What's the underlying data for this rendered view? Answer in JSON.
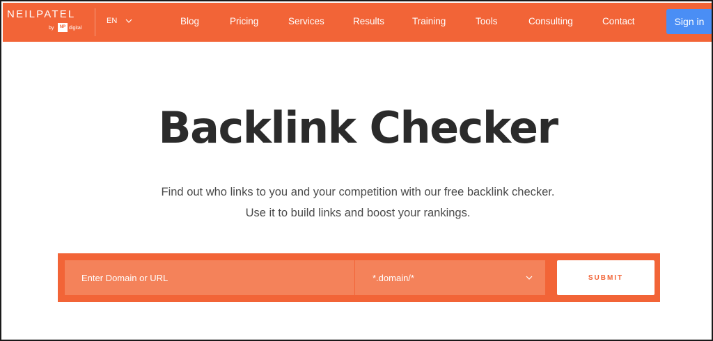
{
  "header": {
    "logo": {
      "wordmark": "NEILPATEL",
      "by": "by",
      "badge": "NP",
      "digital": "digital"
    },
    "language": "EN",
    "nav": [
      {
        "label": "Blog"
      },
      {
        "label": "Pricing"
      },
      {
        "label": "Services"
      },
      {
        "label": "Results"
      },
      {
        "label": "Training"
      },
      {
        "label": "Tools"
      },
      {
        "label": "Consulting"
      },
      {
        "label": "Contact"
      }
    ],
    "signin_label": "Sign in"
  },
  "hero": {
    "title": "Backlink Checker",
    "subtitle_line1": "Find out who links to you and your competition with our free backlink checker.",
    "subtitle_line2": "Use it to build links and boost your rankings."
  },
  "form": {
    "input_placeholder": "Enter Domain or URL",
    "select_value": "*.domain/*",
    "submit_label": "SUBMIT"
  },
  "colors": {
    "brand_orange": "#f26437",
    "field_orange": "#f4825a",
    "signin_blue": "#4a8ef5"
  },
  "icons": {
    "language_chevron": "chevron-down-icon",
    "select_chevron": "chevron-down-icon"
  }
}
